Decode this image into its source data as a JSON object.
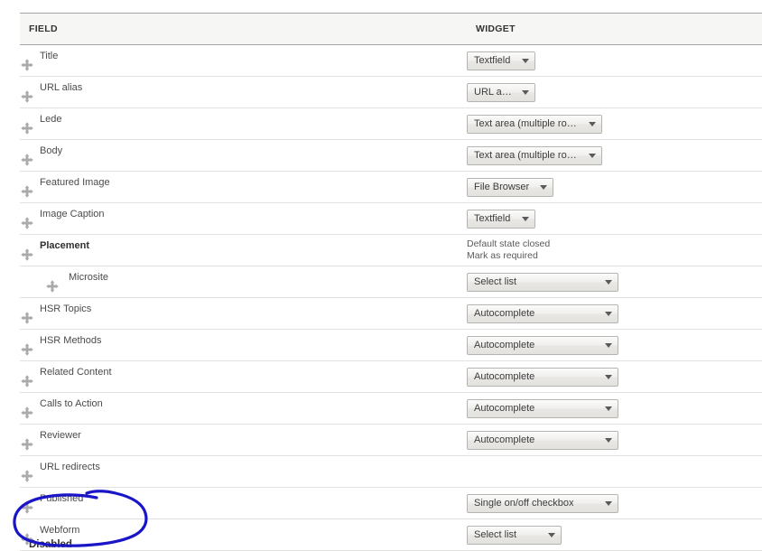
{
  "table": {
    "headers": {
      "field": "FIELD",
      "widget": "WIDGET"
    },
    "rows": [
      {
        "label": "Title",
        "indent": false,
        "bold": false,
        "widget": "Textfield",
        "width": "w-sm",
        "note": null
      },
      {
        "label": "URL alias",
        "indent": false,
        "bold": false,
        "widget": "URL alias",
        "width": "w-sm",
        "note": null
      },
      {
        "label": "Lede",
        "indent": false,
        "bold": false,
        "widget": "Text area (multiple rows)",
        "width": "w-xl",
        "note": null
      },
      {
        "label": "Body",
        "indent": false,
        "bold": false,
        "widget": "Text area (multiple rows)",
        "width": "w-xl",
        "note": null
      },
      {
        "label": "Featured Image",
        "indent": false,
        "bold": false,
        "widget": "File Browser",
        "width": "w-md",
        "note": null
      },
      {
        "label": "Image Caption",
        "indent": false,
        "bold": false,
        "widget": "Textfield",
        "width": "w-sm",
        "note": null
      },
      {
        "label": "Placement",
        "indent": false,
        "bold": true,
        "widget": null,
        "width": null,
        "note": [
          "Default state closed",
          "Mark as required"
        ]
      },
      {
        "label": "Microsite",
        "indent": true,
        "bold": false,
        "widget": "Select list",
        "width": "w-xxl",
        "note": null
      },
      {
        "label": "HSR Topics",
        "indent": false,
        "bold": false,
        "widget": "Autocomplete",
        "width": "w-xxl",
        "note": null
      },
      {
        "label": "HSR Methods",
        "indent": false,
        "bold": false,
        "widget": "Autocomplete",
        "width": "w-xxl",
        "note": null
      },
      {
        "label": "Related Content",
        "indent": false,
        "bold": false,
        "widget": "Autocomplete",
        "width": "w-xxl",
        "note": null
      },
      {
        "label": "Calls to Action",
        "indent": false,
        "bold": false,
        "widget": "Autocomplete",
        "width": "w-xxl",
        "note": null
      },
      {
        "label": "Reviewer",
        "indent": false,
        "bold": false,
        "widget": "Autocomplete",
        "width": "w-xxl",
        "note": null
      },
      {
        "label": "URL redirects",
        "indent": false,
        "bold": false,
        "widget": null,
        "width": null,
        "note": null
      },
      {
        "label": "Published",
        "indent": false,
        "bold": false,
        "widget": "Single on/off checkbox",
        "width": "w-xxl",
        "note": null
      },
      {
        "label": "Webform",
        "indent": false,
        "bold": false,
        "widget": "Select list",
        "width": "w-lg",
        "note": null
      }
    ]
  },
  "disabled_section": {
    "label": "Disabled"
  },
  "annotation": {
    "shape": "hand-drawn-ellipse",
    "color": "#1a16c8",
    "target_row_label": "Webform"
  }
}
